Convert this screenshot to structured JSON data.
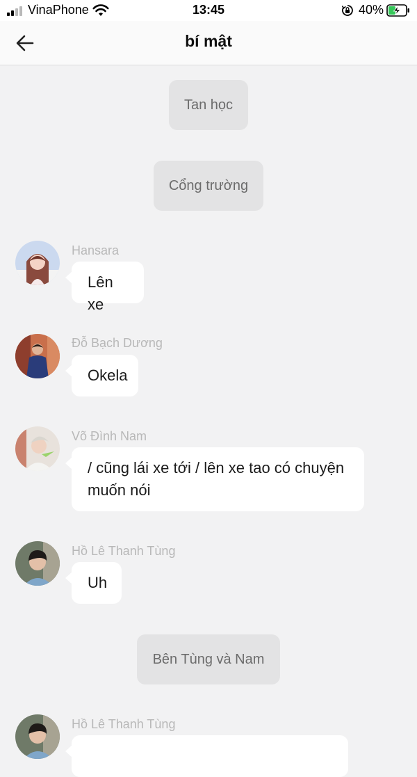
{
  "status_bar": {
    "carrier": "VinaPhone",
    "time": "13:45",
    "battery_percent": "40%",
    "signal_bars_active": 2,
    "signal_bars_total": 4,
    "battery_level": 0.4,
    "battery_charging": true,
    "icons": [
      "signal-icon",
      "wifi-icon",
      "orientation-lock-icon",
      "battery-charging-icon"
    ]
  },
  "header": {
    "title": "bí mật",
    "back_icon": "arrow-left-icon"
  },
  "colors": {
    "background": "#f2f2f3",
    "bubble": "#ffffff",
    "system_bubble": "#e3e3e4",
    "sender_name": "#b8b8b8",
    "battery_green": "#35c759"
  },
  "messages": [
    {
      "type": "system",
      "text": "Tan học"
    },
    {
      "type": "system",
      "text": "Cổng trường"
    },
    {
      "type": "incoming",
      "sender": "Hansara",
      "text": "Lên xe"
    },
    {
      "type": "incoming",
      "sender": "Đỗ Bạch Dương",
      "text": "Okela"
    },
    {
      "type": "incoming",
      "sender": "Võ Đình Nam",
      "text": "/ cũng lái xe tới / lên xe tao có chuyện muốn nói"
    },
    {
      "type": "incoming",
      "sender": "Hồ Lê Thanh Tùng",
      "text": "Uh"
    },
    {
      "type": "system",
      "text": "Bên Tùng và Nam"
    },
    {
      "type": "incoming",
      "sender": "Hồ Lê Thanh Tùng",
      "text": ""
    }
  ]
}
